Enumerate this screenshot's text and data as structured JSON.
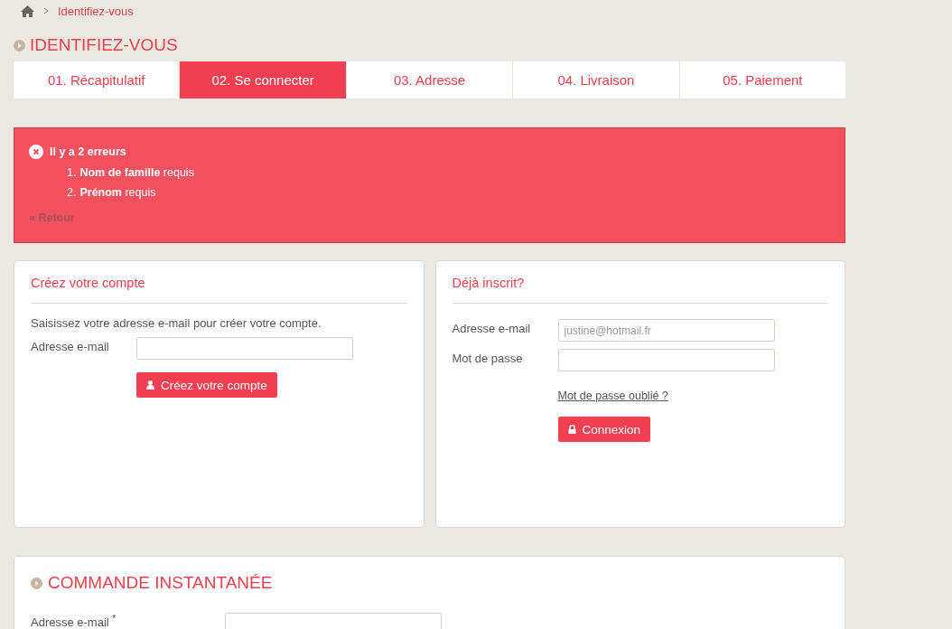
{
  "breadcrumb": {
    "current": "Identifiez-vous"
  },
  "page_title": "IDENTIFIEZ-VOUS",
  "steps": [
    {
      "label": "01. Récapitulatif",
      "selected": false
    },
    {
      "label": "02. Se connecter",
      "selected": true
    },
    {
      "label": "03. Adresse",
      "selected": false
    },
    {
      "label": "04. Livraison",
      "selected": false
    },
    {
      "label": "05. Paiement",
      "selected": false
    }
  ],
  "error_box": {
    "title": "Il y a 2 erreurs",
    "errors": [
      {
        "number": "1.",
        "text": "**Nom de famille** requis"
      },
      {
        "number": "2.",
        "text": "**Prénom** requis"
      }
    ],
    "back_link": "« Retour"
  },
  "create_account": {
    "title": "Créez votre compte",
    "intro": "Saisissez votre adresse e-mail pour créer votre compte.",
    "email_label": "Adresse e-mail",
    "button": "Créez votre compte"
  },
  "login": {
    "title": "Déjà inscrit?",
    "email_label": "Adresse e-mail",
    "email_value": "justine@hotmail.fr",
    "password_label": "Mot de passe",
    "forgot_link": "Mot de passe oublié ?",
    "button": "Connexion"
  },
  "instant_order": {
    "title": "COMMANDE INSTANTANÉE",
    "email_label": "Adresse e-mail",
    "required_mark": "*"
  }
}
